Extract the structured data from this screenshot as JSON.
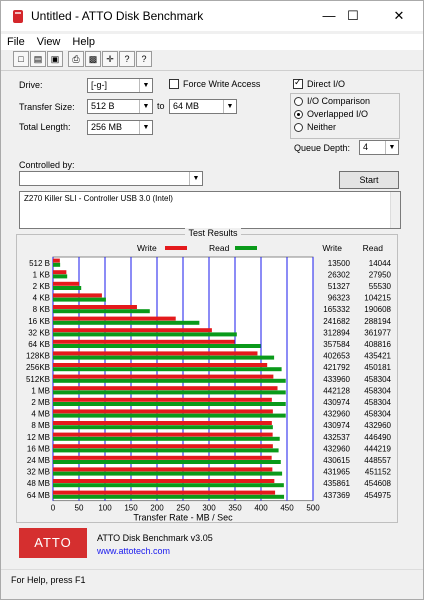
{
  "window": {
    "title": "Untitled - ATTO Disk Benchmark",
    "min_glyph": "—",
    "max_glyph": "☐",
    "close_glyph": "✕"
  },
  "menu": [
    "File",
    "View",
    "Help"
  ],
  "toolbar": {
    "icons": [
      "new-icon",
      "open-icon",
      "save-icon",
      "print-icon",
      "print-preview-icon",
      "move-icon",
      "hint-icon",
      "help-icon"
    ],
    "glyphs": [
      "□",
      "▤",
      "▣",
      "⎙",
      "▩",
      "✛",
      "?",
      "?"
    ]
  },
  "form": {
    "drive_label": "Drive:",
    "drive_value": "[-g-]",
    "force_write_label": "Force Write Access",
    "direct_io_label": "Direct I/O",
    "transfer_size_label": "Transfer Size:",
    "transfer_from": "512 B",
    "to_label": "to",
    "transfer_to": "64 MB",
    "total_length_label": "Total Length:",
    "total_length_value": "256 MB",
    "io_comparison_label": "I/O Comparison",
    "overlapped_io_label": "Overlapped I/O",
    "neither_label": "Neither",
    "queue_depth_label": "Queue Depth:",
    "queue_depth_value": "4",
    "controlled_by_label": "Controlled by:",
    "controlled_by_value": "",
    "start_button": "Start",
    "description": "Z270 Killer SLI - Controller USB 3.0 (Intel)"
  },
  "results": {
    "title": "Test Results",
    "legend_write": "Write",
    "legend_read": "Read",
    "col_write": "Write",
    "col_read": "Read"
  },
  "colors": {
    "write": "#e41a1c",
    "read": "#0a9a1a",
    "grid": "#1a1aee",
    "logo": "#d52f2f"
  },
  "chart_data": {
    "type": "bar",
    "orientation": "horizontal",
    "categories": [
      "512 B",
      "1 KB",
      "2 KB",
      "4 KB",
      "8 KB",
      "16 KB",
      "32 KB",
      "64 KB",
      "128KB",
      "256KB",
      "512KB",
      "1 MB",
      "2 MB",
      "4 MB",
      "8 MB",
      "12 MB",
      "16 MB",
      "24 MB",
      "32 MB",
      "48 MB",
      "64 MB"
    ],
    "series": [
      {
        "name": "Write",
        "values": [
          13500,
          26302,
          51327,
          96323,
          165332,
          241682,
          312894,
          357584,
          402653,
          421792,
          433960,
          442128,
          430974,
          432960,
          430974,
          432537,
          432960,
          430615,
          431965,
          435861,
          437369
        ]
      },
      {
        "name": "Read",
        "values": [
          14044,
          27950,
          55530,
          104215,
          190608,
          288194,
          361977,
          408816,
          435421,
          450181,
          458304,
          458304,
          458304,
          458304,
          432960,
          446490,
          444219,
          448557,
          451152,
          454608,
          454975
        ]
      }
    ],
    "xlabel": "Transfer Rate - MB / Sec",
    "xlim": [
      0,
      500
    ],
    "xticks": [
      "0",
      "50",
      "100",
      "150",
      "200",
      "250",
      "300",
      "350",
      "400",
      "450",
      "500"
    ],
    "grid": true
  },
  "footer": {
    "logo_text": "ATTO",
    "product": "ATTO Disk Benchmark v3.05",
    "url": "www.attotech.com"
  },
  "status": "For Help, press F1"
}
